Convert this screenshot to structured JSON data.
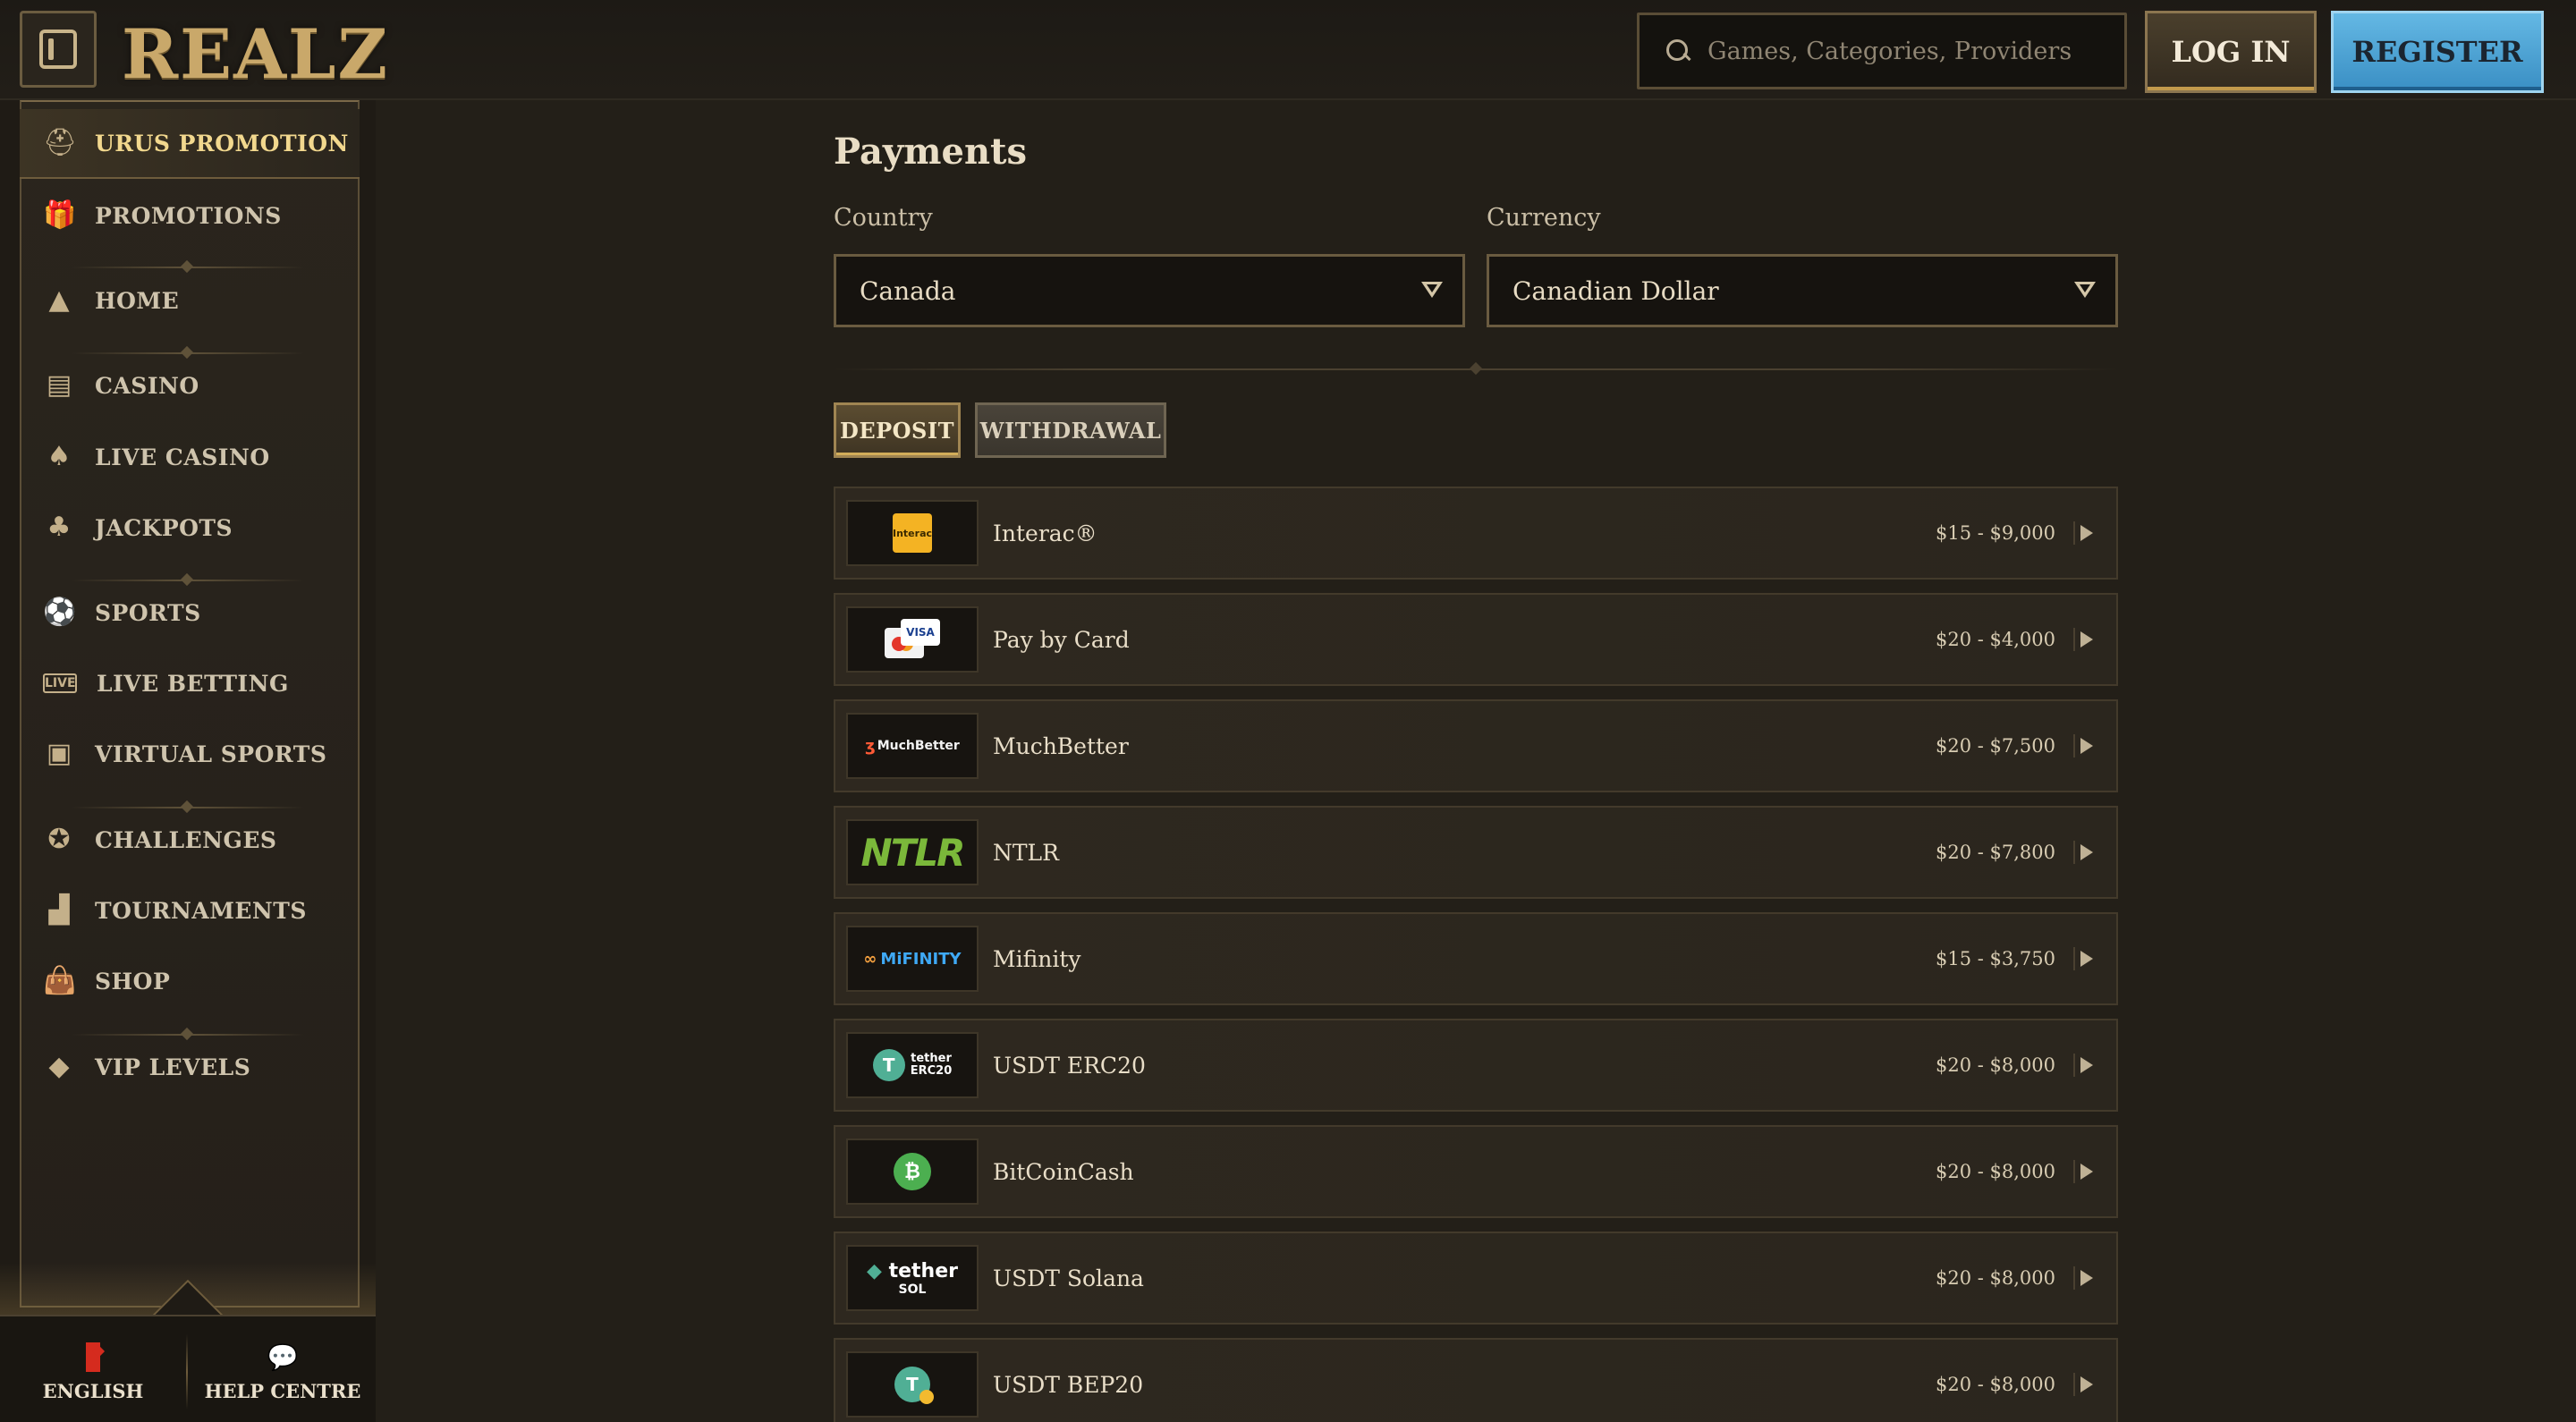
{
  "header": {
    "logo_text": "REALZ",
    "search_placeholder": "Games, Categories, Providers",
    "login_label": "LOG IN",
    "register_label": "REGISTER"
  },
  "sidebar": {
    "items": [
      {
        "label": "URUS PROMOTION",
        "icon": "warrior-helmet-icon",
        "active": true
      },
      {
        "label": "PROMOTIONS",
        "icon": "gift-icon"
      },
      {
        "label": "HOME",
        "icon": "pyramid-icon"
      },
      {
        "label": "CASINO",
        "icon": "slot-machine-icon"
      },
      {
        "label": "LIVE CASINO",
        "icon": "playing-card-icon"
      },
      {
        "label": "JACKPOTS",
        "icon": "clover-icon"
      },
      {
        "label": "SPORTS",
        "icon": "ball-icon"
      },
      {
        "label": "LIVE BETTING",
        "icon": "live-badge-icon"
      },
      {
        "label": "VIRTUAL SPORTS",
        "icon": "virtual-screen-icon"
      },
      {
        "label": "CHALLENGES",
        "icon": "medal-icon"
      },
      {
        "label": "TOURNAMENTS",
        "icon": "podium-icon"
      },
      {
        "label": "SHOP",
        "icon": "shopping-bag-icon"
      },
      {
        "label": "VIP LEVELS",
        "icon": "diamond-icon"
      }
    ],
    "footer": {
      "language_label": "ENGLISH",
      "help_label": "HELP CENTRE"
    }
  },
  "main": {
    "title": "Payments",
    "country_label": "Country",
    "country_value": "Canada",
    "currency_label": "Currency",
    "currency_value": "Canadian Dollar",
    "tabs": [
      {
        "label": "DEPOSIT",
        "active": true
      },
      {
        "label": "WITHDRAWAL",
        "active": false
      }
    ],
    "methods": [
      {
        "name": "Interac®",
        "range": "$15 - $9,000",
        "logo": "interac"
      },
      {
        "name": "Pay by Card",
        "range": "$20 - $4,000",
        "logo": "card"
      },
      {
        "name": "MuchBetter",
        "range": "$20 - $7,500",
        "logo": "muchbetter"
      },
      {
        "name": "NTLR",
        "range": "$20 - $7,800",
        "logo": "ntlr"
      },
      {
        "name": "Mifinity",
        "range": "$15 - $3,750",
        "logo": "mifinity"
      },
      {
        "name": "USDT ERC20",
        "range": "$20 - $8,000",
        "logo": "tether-erc20"
      },
      {
        "name": "BitCoinCash",
        "range": "$20 - $8,000",
        "logo": "bitcoincash"
      },
      {
        "name": "USDT Solana",
        "range": "$20 - $8,000",
        "logo": "tether-sol"
      },
      {
        "name": "USDT BEP20",
        "range": "$20 - $8,000",
        "logo": "tether-bep20"
      }
    ],
    "logo_text": {
      "interac": "Interac",
      "card_brand": "VISA",
      "muchbetter": "MuchBetter",
      "ntlr": "NTLR",
      "mifinity": "MiFINITY",
      "tether_word": "tether",
      "erc20": "ERC20",
      "sol": "SOL",
      "tether_t": "T",
      "bch_symbol": "₿"
    }
  },
  "colors": {
    "accent_gold": "#c9a86a",
    "register_blue": "#4aa3d6",
    "background": "#231f18"
  }
}
